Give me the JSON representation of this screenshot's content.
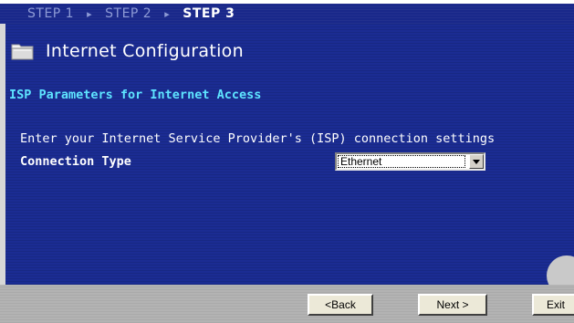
{
  "steps": {
    "step1": "STEP 1",
    "step2": "STEP 2",
    "step3": "STEP 3",
    "separator": "▸"
  },
  "header": {
    "title": "Internet Configuration",
    "icon": "folder-icon"
  },
  "section": {
    "title": "ISP Parameters for Internet Access"
  },
  "form": {
    "description": "Enter your Internet Service Provider's (ISP) connection settings",
    "connection_type_label": "Connection Type",
    "connection_type_value": "Ethernet"
  },
  "buttons": {
    "back": "<Back",
    "next": "Next >",
    "exit": "Exit"
  },
  "colors": {
    "panel": "#1b2c93",
    "accent_heading": "#5ee4ff",
    "inactive_step": "#8e9bd6"
  }
}
